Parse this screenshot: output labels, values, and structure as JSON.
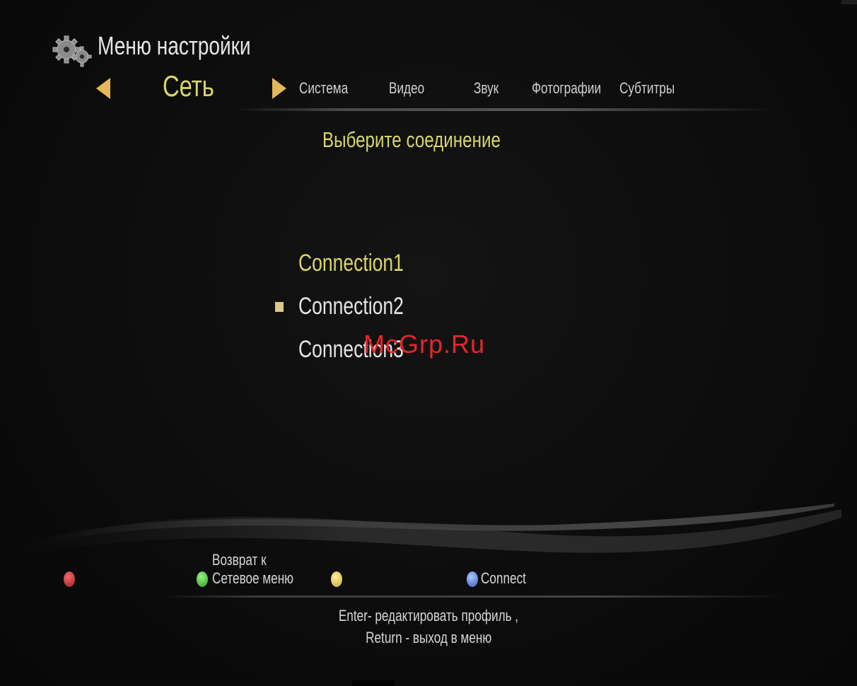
{
  "header": {
    "title": "Меню настройки",
    "icon": "gear-icon"
  },
  "tabs": {
    "current": "Сеть",
    "items": [
      "Система",
      "Видео",
      "Звук",
      "Фотографии",
      "Субтитры"
    ]
  },
  "main": {
    "subtitle": "Выберите соединение",
    "connections": [
      "Connection1",
      "Connection2",
      "Connection3"
    ],
    "selected_index": 1
  },
  "watermark": "McGrp.Ru",
  "footer": {
    "green_label_line1": "Возврат к",
    "green_label_line2": "Сетевое меню",
    "blue_label": "Connect",
    "help_line1": "Enter- редактировать профиль ,",
    "help_line2": "Return - выход в меню"
  },
  "colors": {
    "accent": "#d8d66a",
    "arrow": "#e3b75a",
    "red_button": "#c93a3a",
    "green_button": "#5bd04f",
    "yellow_button": "#e6cf64",
    "blue_button": "#6f93e6"
  }
}
